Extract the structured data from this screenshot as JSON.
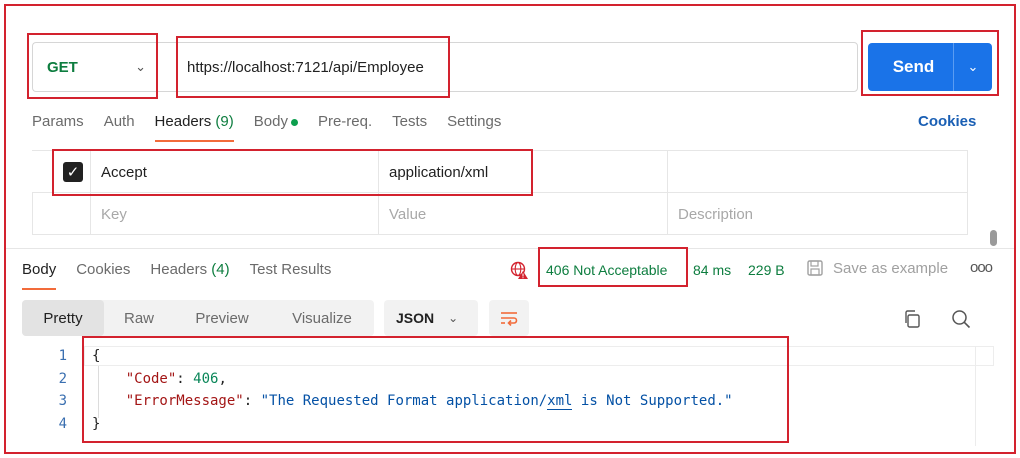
{
  "request": {
    "method": "GET",
    "url": "https://localhost:7121/api/Employee",
    "send_label": "Send"
  },
  "request_tabs": [
    {
      "label": "Params",
      "count": ""
    },
    {
      "label": "Auth",
      "count": ""
    },
    {
      "label": "Headers",
      "count": "(9)",
      "active": true
    },
    {
      "label": "Body",
      "count": ""
    },
    {
      "label": "Pre-req.",
      "count": ""
    },
    {
      "label": "Tests",
      "count": ""
    },
    {
      "label": "Settings",
      "count": ""
    }
  ],
  "cookies_link": "Cookies",
  "headers_table": {
    "row": {
      "checked": true,
      "key": "Accept",
      "value": "application/xml",
      "description": ""
    },
    "placeholders": {
      "key": "Key",
      "value": "Value",
      "description": "Description"
    }
  },
  "response_tabs": [
    {
      "label": "Body",
      "count": "",
      "active": true
    },
    {
      "label": "Cookies",
      "count": ""
    },
    {
      "label": "Headers",
      "count": "(4)"
    },
    {
      "label": "Test Results",
      "count": ""
    }
  ],
  "response_meta": {
    "status": "406 Not Acceptable",
    "time": "84 ms",
    "size": "229 B",
    "save_label": "Save as example",
    "more": "ooo"
  },
  "view_modes": [
    "Pretty",
    "Raw",
    "Preview",
    "Visualize"
  ],
  "format_select": "JSON",
  "code": {
    "line_numbers": [
      "1",
      "2",
      "3",
      "4"
    ],
    "open_brace": "{",
    "close_brace": "}",
    "code_key": "\"Code\"",
    "code_value": "406",
    "error_key": "\"ErrorMessage\"",
    "error_value_a": "\"The Requested Format application/",
    "error_value_b": "xml",
    "error_value_c": " is Not Supported.\""
  },
  "colors": {
    "accent": "#1a73e8",
    "success": "#0d7d3f",
    "highlight_box": "#d3222e",
    "active_tab_underline": "#f26b3a"
  },
  "icons": [
    "chevron-down-icon",
    "checkbox-checked-icon",
    "globe-warning-icon",
    "save-icon",
    "more-icon",
    "wrap-lines-icon",
    "copy-icon",
    "search-icon"
  ]
}
